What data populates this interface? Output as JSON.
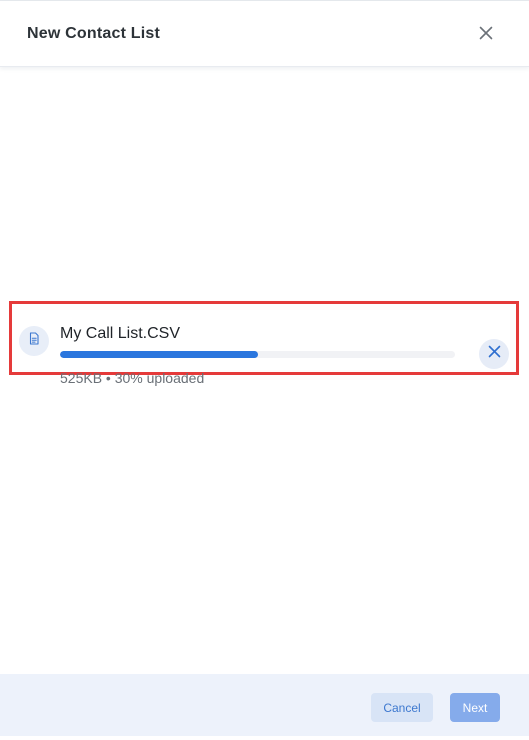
{
  "dialog": {
    "title": "New Contact List",
    "close_icon": "close-icon"
  },
  "upload": {
    "file_name": "My Call List.CSV",
    "file_icon": "document-icon",
    "progress_fraction": 0.5,
    "meta_text": "525KB • 30% uploaded",
    "remove_icon": "close-icon"
  },
  "footer": {
    "cancel_label": "Cancel",
    "next_label": "Next"
  },
  "colors": {
    "progress_fill": "#2a76de",
    "highlight_border": "#e53a3a",
    "footer_bg": "#edf2fb",
    "next_button_bg": "#85abeb",
    "cancel_button_bg": "#d8e4f6"
  }
}
